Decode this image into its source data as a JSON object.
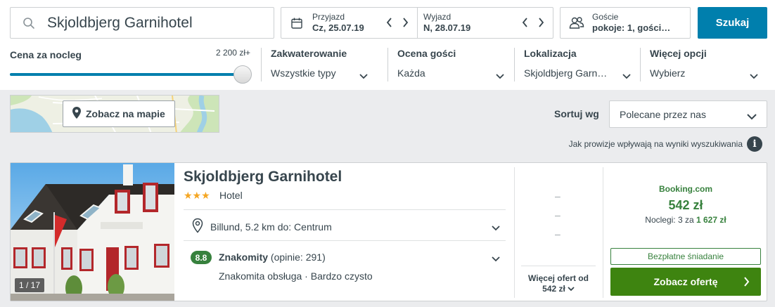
{
  "search": {
    "destination": "Skjoldbjerg Garnihotel",
    "checkin_label": "Przyjazd",
    "checkin_value": "Cz, 25.07.19",
    "checkout_label": "Wyjazd",
    "checkout_value": "N, 28.07.19",
    "guests_label": "Goście",
    "guests_value": "pokoje: 1, gości…",
    "search_button": "Szukaj"
  },
  "filters": {
    "price_label": "Cena za nocleg",
    "price_max": "2 200 zł+",
    "price_slider_fraction": 1.0,
    "items": [
      {
        "title": "Zakwaterowanie",
        "value": "Wszystkie typy"
      },
      {
        "title": "Ocena gości",
        "value": "Każda"
      },
      {
        "title": "Lokalizacja",
        "value": "Skjoldbjerg Garn…"
      },
      {
        "title": "Więcej opcji",
        "value": "Wybierz"
      }
    ]
  },
  "map": {
    "button_label": "Zobacz na mapie"
  },
  "sort": {
    "label": "Sortuj wg",
    "value": "Polecane przez nas"
  },
  "provisions_note": "Jak prowizje wpływają na wyniki wyszukiwania",
  "result": {
    "photo_count": "1 / 17",
    "photo_sign": "Skjoldbjerg Garnihotel",
    "name": "Skjoldbjerg Garnihotel",
    "stars": 3,
    "stars_glyphs": "★★★",
    "type": "Hotel",
    "location": "Billund, 5.2 km do: Centrum",
    "rating_score": "8.8",
    "rating_word": "Znakomity",
    "rating_count": "(opinie: 291)",
    "rating_highlights": "Znakomita obsługa · Bardzo czysto",
    "alt_prices": [
      "–",
      "–",
      "–"
    ],
    "more_offers_line1": "Więcej ofert od",
    "more_offers_line2": "542 zł",
    "provider": "Booking.com",
    "price": "542 zł",
    "nights_prefix": "Noclegi: 3 za",
    "nights_total": "1 627 zł",
    "breakfast": "Bezpłatne śniadanie",
    "deal_button": "Zobacz ofertę"
  }
}
